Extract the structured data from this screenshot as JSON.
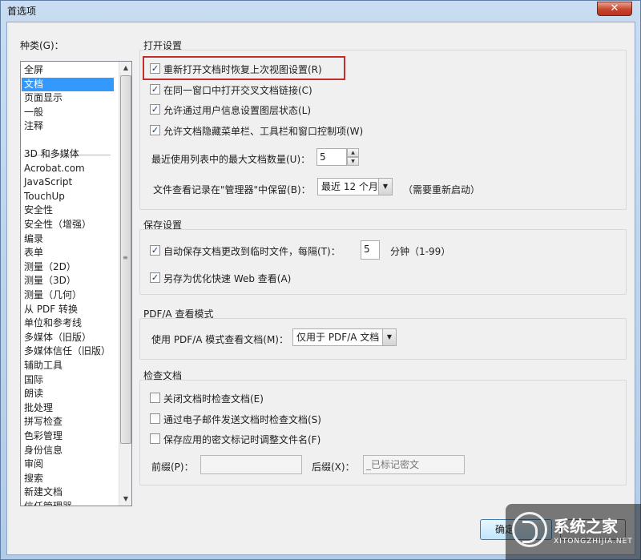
{
  "window": {
    "title": "首选项",
    "close_glyph": "✕"
  },
  "sidebar": {
    "label": "种类(G)：",
    "items_top": [
      "全屏",
      "文档",
      "页面显示",
      "一般",
      "注释"
    ],
    "items": [
      "3D 和多媒体",
      "Acrobat.com",
      "JavaScript",
      "TouchUp",
      "安全性",
      "安全性（增强）",
      "编录",
      "表单",
      "测量（2D）",
      "测量（3D）",
      "测量（几何）",
      "从 PDF 转换",
      "单位和参考线",
      "多媒体（旧版）",
      "多媒体信任（旧版）",
      "辅助工具",
      "国际",
      "朗读",
      "批处理",
      "拼写检查",
      "色彩管理",
      "身份信息",
      "审阅",
      "搜索",
      "新建文档",
      "信任管理器"
    ],
    "selected": "文档"
  },
  "open_settings": {
    "title": "打开设置",
    "restore_view": {
      "label": "重新打开文档时恢复上次视图设置(R)",
      "checked": true
    },
    "open_cross_links": {
      "label": "在同一窗口中打开交叉文档链接(C)",
      "checked": true
    },
    "layer_state": {
      "label": "允许通过用户信息设置图层状态(L)",
      "checked": true
    },
    "hide_bars": {
      "label": "允许文档隐藏菜单栏、工具栏和窗口控制项(W)",
      "checked": true
    },
    "recent_max_label": "最近使用列表中的最大文档数量(U)：",
    "recent_max_value": "5",
    "history_label": "文件查看记录在\"管理器\"中保留(B)：",
    "history_value": "最近 12 个月",
    "restart_note": "（需要重新启动）"
  },
  "save_settings": {
    "title": "保存设置",
    "autosave": {
      "label": "自动保存文档更改到临时文件，每隔(T)：",
      "checked": true
    },
    "autosave_value": "5",
    "autosave_unit": "分钟（1-99）",
    "fast_web": {
      "label": "另存为优化快速 Web 查看(A)",
      "checked": true
    }
  },
  "pdfa": {
    "title": "PDF/A 查看模式",
    "mode_label": "使用 PDF/A 模式查看文档(M)：",
    "mode_value": "仅用于 PDF/A 文档"
  },
  "inspect": {
    "title": "检查文档",
    "on_close": {
      "label": "关闭文档时检查文档(E)",
      "checked": false
    },
    "on_email": {
      "label": "通过电子邮件发送文档时检查文档(S)",
      "checked": false
    },
    "on_save": {
      "label": "保存应用的密文标记时调整文件名(F)",
      "checked": false
    },
    "prefix_label": "前缀(P)：",
    "prefix_value": "",
    "suffix_label": "后缀(X)：",
    "suffix_value": "_已标记密文"
  },
  "buttons": {
    "ok": "确定"
  },
  "watermark": {
    "brand": "系统之家",
    "url": "XITONGZHIJIA.NET"
  },
  "check_glyph": "✓",
  "arrows": {
    "up": "▲",
    "down": "▼",
    "grip": "≡"
  }
}
